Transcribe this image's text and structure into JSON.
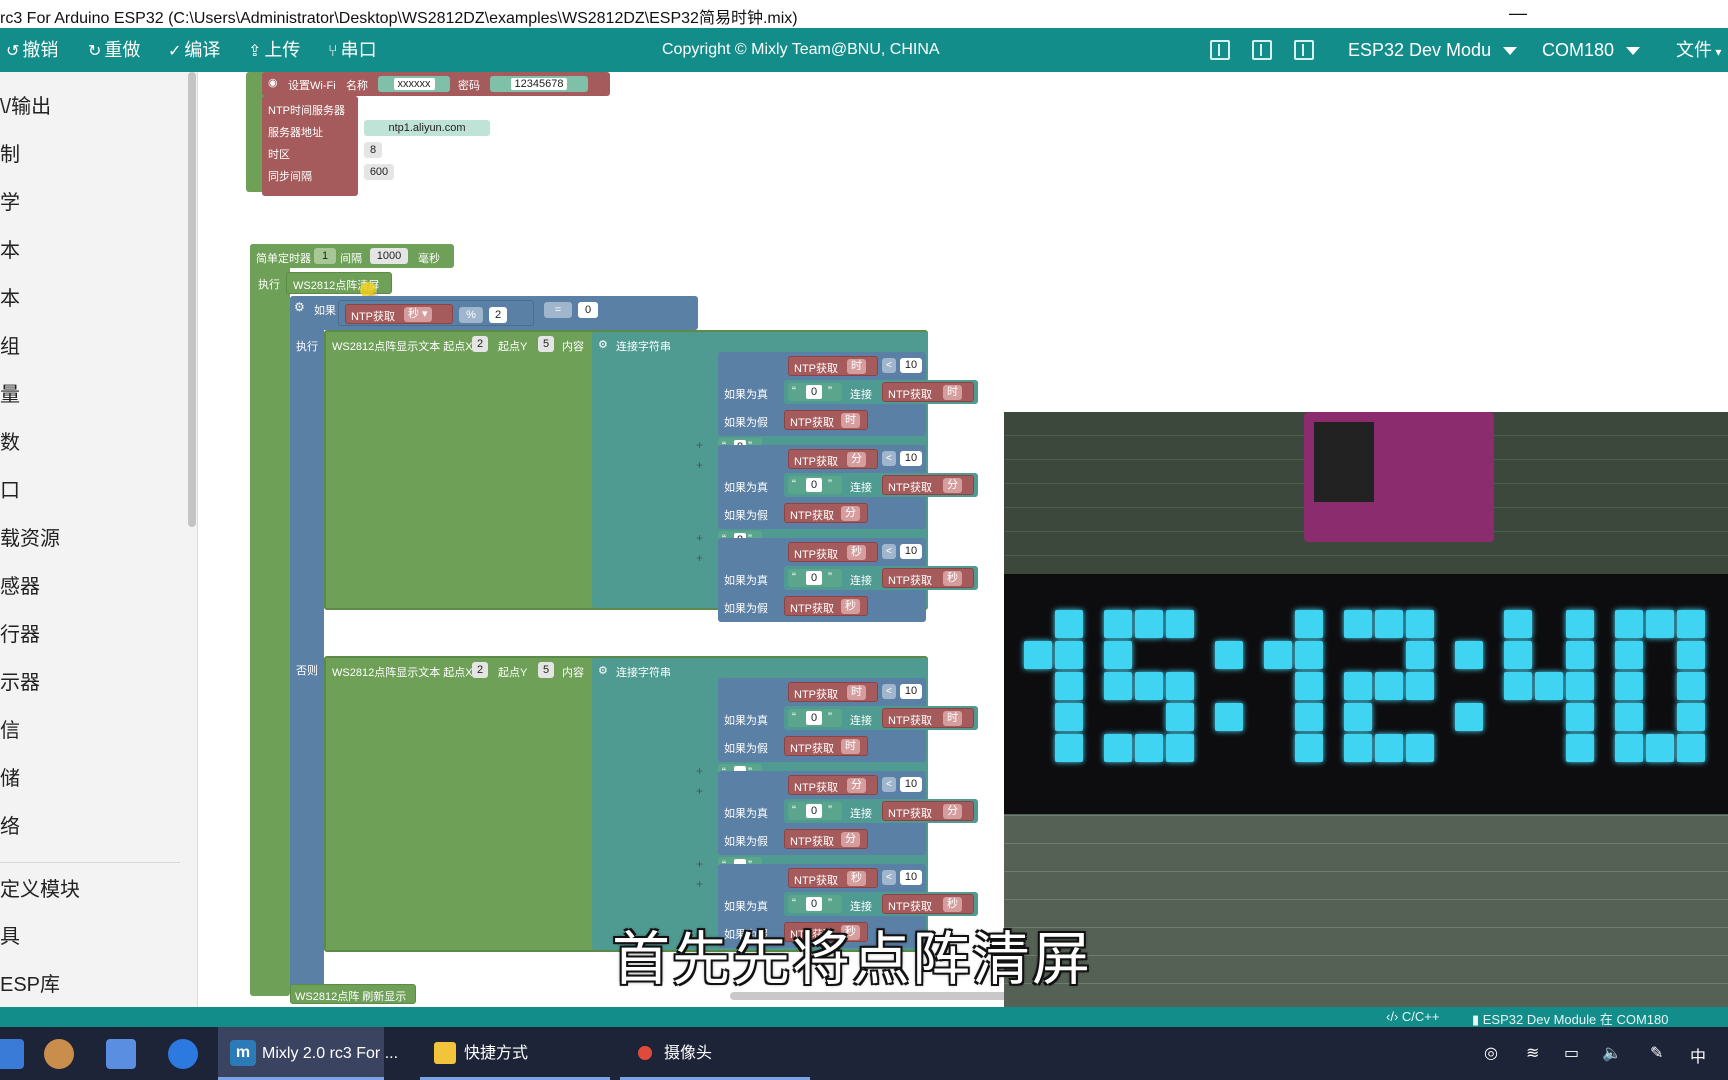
{
  "window": {
    "title": "rc3 For Arduino ESP32 (C:\\Users\\Administrator\\Desktop\\WS2812DZ\\examples\\WS2812DZ\\ESP32简易时钟.mix)",
    "minimize": "—"
  },
  "toolbar": {
    "undo": "撤销",
    "redo": "重做",
    "compile": "编译",
    "upload": "上传",
    "serial": "串口",
    "copyright": "Copyright © Mixly Team@BNU, CHINA",
    "board": "ESP32 Dev Modu",
    "port": "COM180",
    "file_menu": "文件"
  },
  "sidebar": {
    "items": [
      "\\/输出",
      "制",
      "学",
      "本",
      "本",
      "组",
      "量",
      "数",
      "口",
      "载资源",
      "感器",
      "行器",
      "示器",
      "信",
      "储",
      "络",
      "定义模块",
      "具",
      "ESP库"
    ]
  },
  "blocks": {
    "wifi": {
      "label": "设置Wi-Fi",
      "name_label": "名称",
      "name": "xxxxxx",
      "pwd_label": "密码",
      "pwd": "12345678"
    },
    "ntp": {
      "label": "NTP时间服务器",
      "server_label": "服务器地址",
      "server": "ntp1.aliyun.com",
      "tz_label": "时区",
      "tz": "8",
      "sync_label": "同步间隔",
      "sync": "600"
    },
    "timer": {
      "label": "简单定时器",
      "index": "1",
      "interval_label": "间隔",
      "interval": "1000",
      "unit": "毫秒"
    },
    "exec": "执行",
    "clear": "WS2812点阵清屏",
    "if": "如果",
    "ntp_get": "NTP获取",
    "sec": "秒",
    "min": "分",
    "hour": "时",
    "mod": "%",
    "two": "2",
    "eq": "=",
    "zero": "0",
    "then": "执行",
    "else": "否则",
    "show_text": "WS2812点阵显示文本 起点X",
    "x": "2",
    "y_label": "起点Y",
    "y": "5",
    "content": "内容",
    "concat": "连接字符串",
    "lt": "<",
    "ten": "10",
    "if_true": "如果为真",
    "if_false": "如果为假",
    "str_zero": "0",
    "join": "连接",
    "colon": "8",
    "refresh": "WS2812点阵 刷新显示",
    "plus": "+"
  },
  "subtitle": "首先先将点阵清屏",
  "statusbar": {
    "lang": "C/C++",
    "device": "ESP32 Dev Module 在 COM180"
  },
  "taskbar": {
    "apps": [
      "Mixly 2.0 rc3 For ...",
      "快捷方式",
      "摄像头"
    ],
    "tray_ime": "中"
  }
}
